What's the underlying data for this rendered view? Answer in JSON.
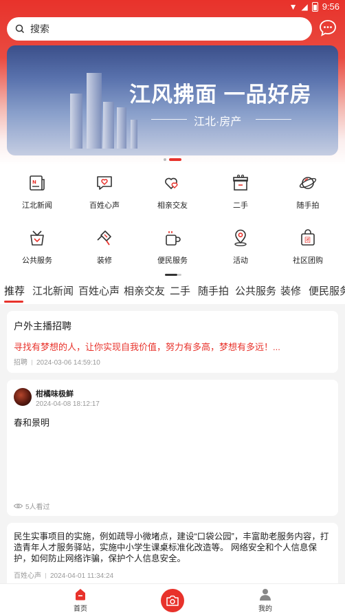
{
  "status_bar": {
    "time": "9:56"
  },
  "search": {
    "placeholder": "搜索"
  },
  "banner": {
    "title": "江风拂面 一品好房",
    "subtitle": "江北·房产"
  },
  "grid": [
    {
      "label": "江北新闻",
      "icon": "newspaper-icon"
    },
    {
      "label": "百姓心声",
      "icon": "heart-chat-icon"
    },
    {
      "label": "相亲交友",
      "icon": "double-heart-icon"
    },
    {
      "label": "二手",
      "icon": "secondhand-box-icon"
    },
    {
      "label": "随手拍",
      "icon": "planet-icon"
    },
    {
      "label": "公共服务",
      "icon": "gift-bag-icon"
    },
    {
      "label": "装修",
      "icon": "brush-icon"
    },
    {
      "label": "便民服务",
      "icon": "coffee-cup-icon"
    },
    {
      "label": "活动",
      "icon": "location-pin-icon"
    },
    {
      "label": "社区团购",
      "icon": "group-buy-bag-icon"
    }
  ],
  "tabs": [
    "推荐",
    "江北新闻",
    "百姓心声",
    "相亲交友",
    "二手",
    "随手拍",
    "公共服务",
    "装修",
    "便民服务"
  ],
  "posts": [
    {
      "title": "户外主播招聘",
      "highlight": "寻找有梦想的人，让你实现自我价值，努力有多高，梦想有多远！...",
      "category": "招聘",
      "time": "2024-03-06 14:59:10"
    },
    {
      "author": "柑橘味极鲜",
      "time": "2024-04-08 18:12:17",
      "text": "春和景明",
      "views": "5人看过"
    },
    {
      "text": "民生实事项目的实施，例如疏导小微堵点，建设“口袋公园”，丰富助老服务内容，打造青年人才服务驿站，实施中小学生课桌标准化改造等。 网络安全和个人信息保护，如何防止网络诈骗，保护个人信息安全。",
      "category": "百姓心声",
      "time": "2024-04-01 11:34:24"
    }
  ],
  "bottom_nav": {
    "home": "首页",
    "mine": "我的"
  },
  "colors": {
    "accent": "#e8322b"
  }
}
